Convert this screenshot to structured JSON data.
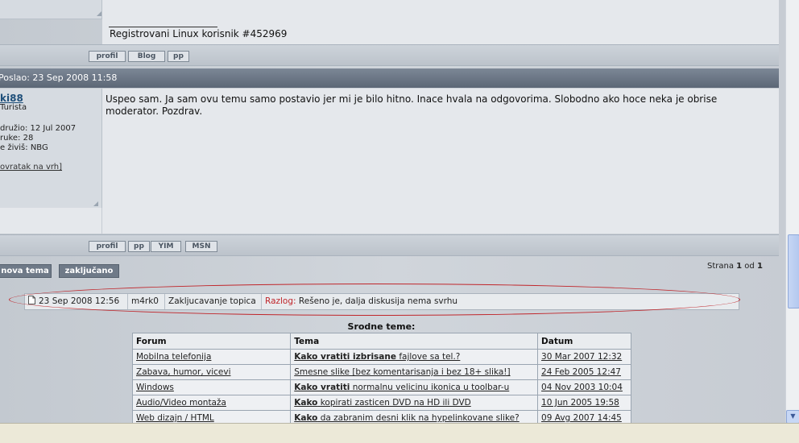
{
  "post1": {
    "signature": "Registrovani Linux korisnik #452969",
    "buttons": [
      "profil",
      "Blog",
      "pp"
    ]
  },
  "post2": {
    "header": "Poslao: 23 Sep 2008 11:58",
    "username": "ki88",
    "rank": "Turista",
    "joined": "družio: 12 Jul 2007",
    "posts": "ruke: 28",
    "location": "e živiš: NBG",
    "back_to_top": "ovratak na vrh]",
    "message": "Uspeo sam. Ja sam ovu temu samo postavio jer mi je bilo hitno. Inace hvala na odgovorima. Slobodno ako hoce neka je obrise moderator. Pozdrav.",
    "buttons": [
      "profil",
      "pp",
      "YIM",
      "MSN"
    ]
  },
  "actions": {
    "new_topic": "nova tema",
    "locked": "zaključano"
  },
  "pagination": {
    "prefix": "Strana ",
    "current": "1",
    "of": " od ",
    "total": "1"
  },
  "moderator_log": {
    "date": "23 Sep 2008 12:56",
    "user": "m4rk0",
    "action": "Zakljucavanje topica",
    "reason_label": "Razlog:",
    "reason": "Rešeno je, dalja diskusija nema svrhu"
  },
  "related": {
    "title": "Srodne teme:",
    "headers": [
      "Forum",
      "Tema",
      "Datum"
    ],
    "rows": [
      {
        "forum": "Mobilna telefonija",
        "topic_bold": "Kako vratiti izbrisane",
        "topic_rest": " fajlove sa tel.?",
        "date": "30 Mar 2007 12:32"
      },
      {
        "forum": "Zabava, humor, vicevi",
        "topic_bold": "",
        "topic_rest": "Smesne slike [bez komentarisanja i bez 18+ slika!]",
        "date": "24 Feb 2005 12:47"
      },
      {
        "forum": "Windows",
        "topic_bold": "Kako vratiti",
        "topic_rest": " normalnu velicinu ikonica u toolbar-u",
        "date": "04 Nov 2003 10:04"
      },
      {
        "forum": "Audio/Video montaža",
        "topic_bold": "Kako",
        "topic_rest": " kopirati zasticen DVD na HD ili DVD",
        "date": "10 Jun 2005 19:58"
      },
      {
        "forum": "Web dizajn / HTML",
        "topic_bold": "Kako",
        "topic_rest": " da zabranim desni klik na hypelinkovane slike?",
        "date": "09 Avg 2007 14:45"
      }
    ]
  },
  "colors": {
    "header_bar": "#6c7786",
    "highlight_ellipse": "#c0262b",
    "button_dark": "#6f7a88"
  }
}
